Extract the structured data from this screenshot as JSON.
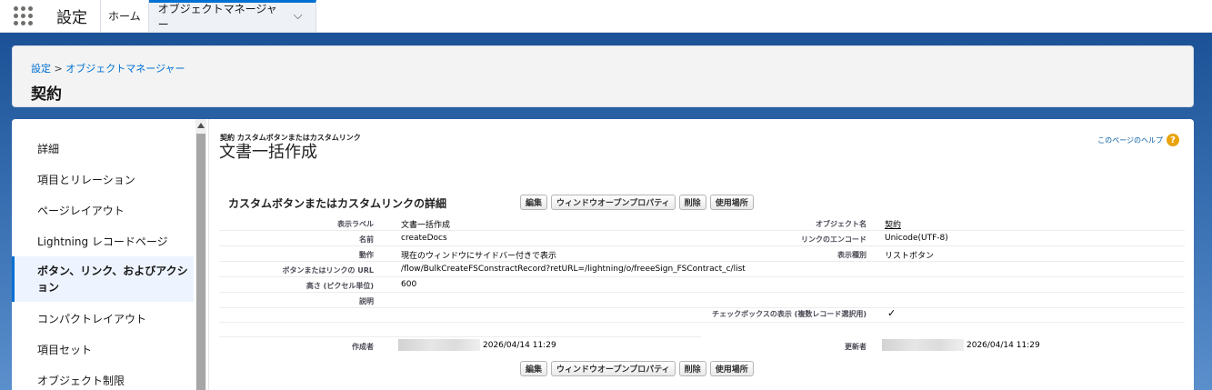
{
  "topbar": {
    "app_name": "設定",
    "tabs": [
      {
        "label": "ホーム"
      },
      {
        "label": "オブジェクトマネージャー"
      }
    ]
  },
  "header": {
    "breadcrumb": [
      "設定",
      "オブジェクトマネージャー"
    ],
    "breadcrumb_sep": ">",
    "title": "契約"
  },
  "sidebar": {
    "items": [
      {
        "label": "詳細"
      },
      {
        "label": "項目とリレーション"
      },
      {
        "label": "ページレイアウト"
      },
      {
        "label": "Lightning レコードページ"
      },
      {
        "label": "ボタン、リンク、およびアクション"
      },
      {
        "label": "コンパクトレイアウト"
      },
      {
        "label": "項目セット"
      },
      {
        "label": "オブジェクト制限"
      }
    ],
    "active_index": 4
  },
  "content": {
    "crumb": "契約 カスタムボタンまたはカスタムリンク",
    "title": "文書一括作成",
    "help": "このページのヘルプ",
    "section_title": "カスタムボタンまたはカスタムリンクの詳細",
    "buttons": [
      "編集",
      "ウィンドウオープンプロパティ",
      "削除",
      "使用場所"
    ],
    "details": {
      "display_label": {
        "label": "表示ラベル",
        "value": "文書一括作成"
      },
      "object_name": {
        "label": "オブジェクト名",
        "value": "契約"
      },
      "name": {
        "label": "名前",
        "value": "createDocs"
      },
      "link_encoding": {
        "label": "リンクのエンコード",
        "value": "Unicode(UTF-8)"
      },
      "behavior": {
        "label": "動作",
        "value": "現在のウィンドウにサイドバー付きで表示"
      },
      "display_type": {
        "label": "表示種別",
        "value": "リストボタン"
      },
      "url": {
        "label": "ボタンまたはリンクの URL",
        "value": "/flow/BulkCreateFSConstractRecord?retURL=/lightning/o/freeeSign_FSContract_c/list"
      },
      "height": {
        "label": "高さ (ピクセル単位)",
        "value": "600"
      },
      "description": {
        "label": "説明",
        "value": ""
      },
      "checkbox": {
        "label": "チェックボックスの表示 (複数レコード選択用)",
        "value": "✓"
      },
      "created_by": {
        "label": "作成者",
        "date": "2026/04/14 11:29"
      },
      "modified_by": {
        "label": "更新者",
        "date": "2026/04/14 11:29"
      }
    }
  }
}
